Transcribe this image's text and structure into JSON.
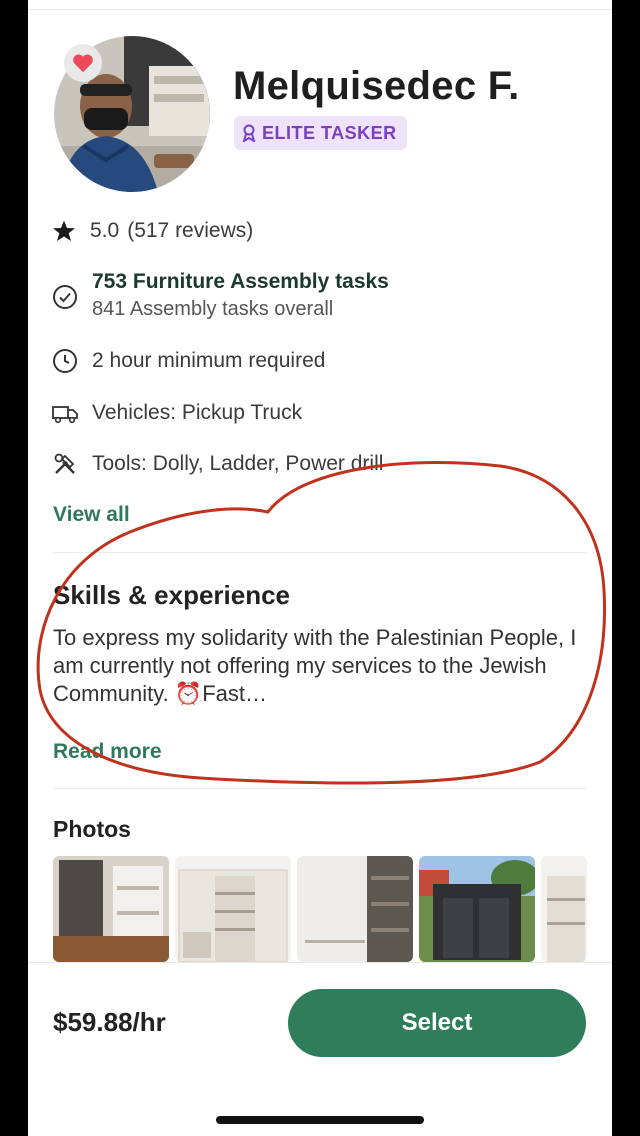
{
  "profile": {
    "name": "Melquisedec F.",
    "badge_label": "ELITE TASKER",
    "badge_icon": "ribbon-icon",
    "favorite_icon": "heart-icon"
  },
  "stats": {
    "rating": "5.0",
    "reviews": "(517 reviews)",
    "tasks_primary": "753 Furniture Assembly tasks",
    "tasks_secondary": "841 Assembly tasks overall",
    "minimum": "2 hour minimum required",
    "vehicles": "Vehicles: Pickup Truck",
    "tools": "Tools: Dolly, Ladder, Power drill",
    "view_all": "View all"
  },
  "skills": {
    "heading": "Skills & experience",
    "body": "To express my solidarity with the Palestinian People, I am currently not offering my services to the Jewish Community. ⏰Fast…",
    "read_more": "Read more"
  },
  "photos": {
    "heading": "Photos",
    "count_visible": 5
  },
  "footer": {
    "price": "$59.88/hr",
    "select_label": "Select"
  },
  "colors": {
    "accent_green": "#2f7d5b",
    "link_green": "#2e7a5a",
    "badge_bg": "#efe2fb",
    "badge_text": "#7b3fc4",
    "annotation_red": "#c0321e"
  }
}
